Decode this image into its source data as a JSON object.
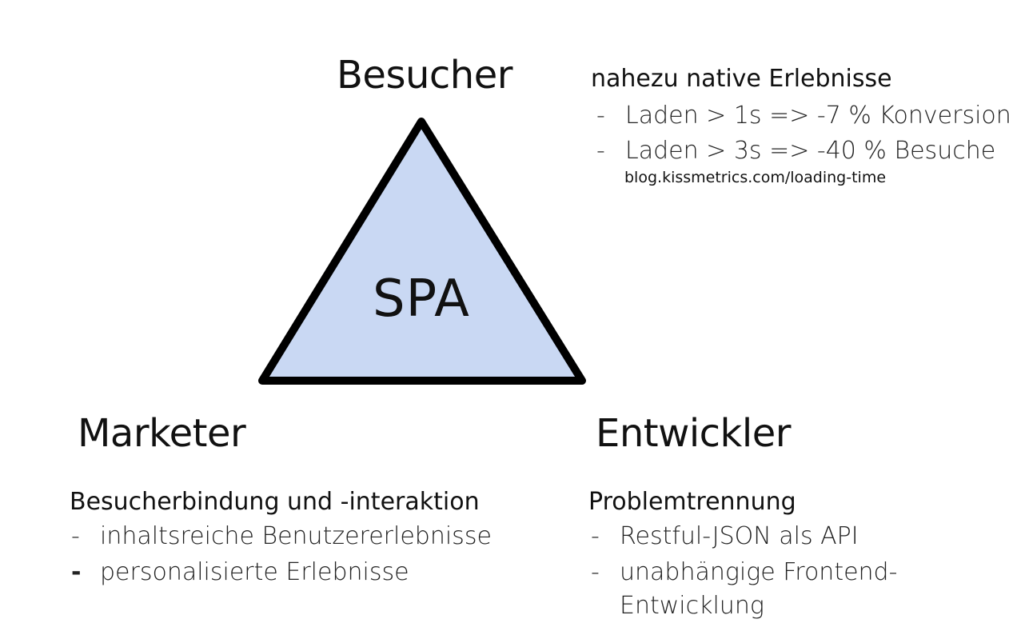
{
  "diagram": {
    "center_label": "SPA",
    "colors": {
      "triangle_fill": "#c9d8f3",
      "triangle_stroke": "#000000",
      "text": "#111111"
    },
    "besucher": {
      "title": "Besucher",
      "heading": "nahezu native Erlebnisse",
      "bullets": [
        {
          "dash": "-",
          "text": "Laden > 1s => -7 % Konversion"
        },
        {
          "dash": "-",
          "text": "Laden > 3s => -40 % Besuche"
        }
      ],
      "source": "blog.kissmetrics.com/loading-time"
    },
    "marketer": {
      "title": "Marketer",
      "heading": "Besucherbindung und -interaktion",
      "bullets": [
        {
          "dash": "-",
          "text": "inhaltsreiche Benutzererlebnisse"
        },
        {
          "dash": "-",
          "text": "personalisierte Erlebnisse"
        }
      ]
    },
    "entwickler": {
      "title": "Entwickler",
      "heading": "Problemtrennung",
      "bullets": [
        {
          "dash": "-",
          "text": "Restful-JSON als API"
        },
        {
          "dash": "-",
          "text": "unabhängige Frontend-"
        }
      ],
      "continuation": "Entwicklung"
    }
  }
}
